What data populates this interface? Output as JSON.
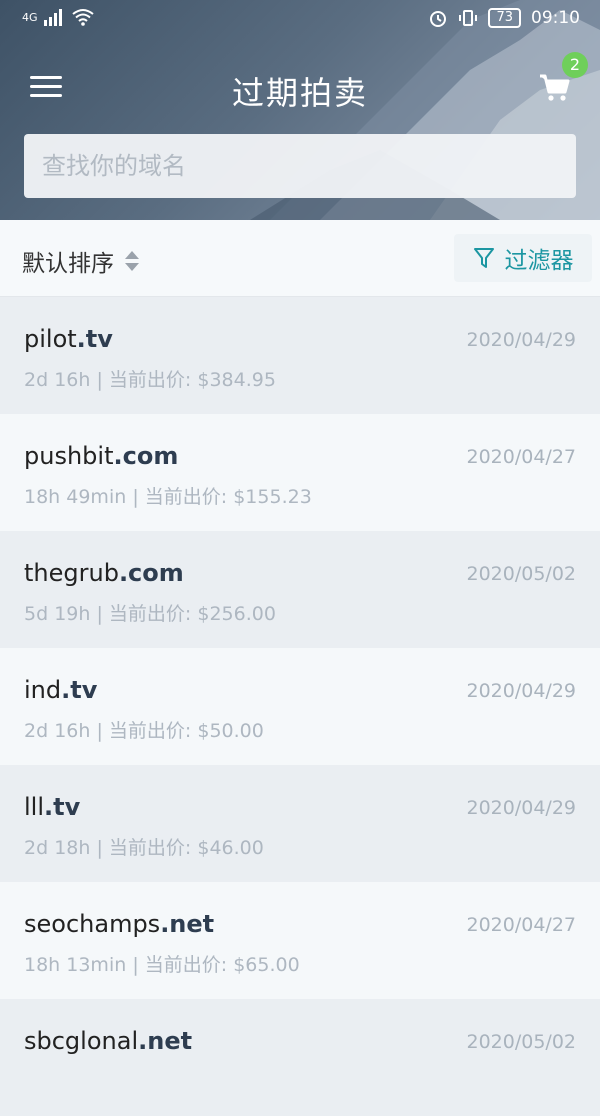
{
  "status_bar": {
    "network": "4G",
    "battery": "73",
    "time": "09:10"
  },
  "header": {
    "title": "过期拍卖",
    "cart_count": "2",
    "search_placeholder": "查找你的域名"
  },
  "toolbar": {
    "sort_label": "默认排序",
    "filter_label": "过滤器"
  },
  "colors": {
    "accent": "#1c96a2",
    "badge": "#6fcf5a"
  },
  "items": [
    {
      "name": "pilot",
      "tld": ".tv",
      "time": "2d  16h",
      "sep": "|",
      "bid_label": "当前出价:",
      "price": "$384.95",
      "date": "2020/04/29"
    },
    {
      "name": "pushbit",
      "tld": ".com",
      "time": "18h  49min",
      "sep": "|",
      "bid_label": "当前出价:",
      "price": "$155.23",
      "date": "2020/04/27"
    },
    {
      "name": "thegrub",
      "tld": ".com",
      "time": "5d  19h",
      "sep": "|",
      "bid_label": "当前出价:",
      "price": "$256.00",
      "date": "2020/05/02"
    },
    {
      "name": "ind",
      "tld": ".tv",
      "time": "2d  16h",
      "sep": "|",
      "bid_label": "当前出价:",
      "price": "$50.00",
      "date": "2020/04/29"
    },
    {
      "name": "lll",
      "tld": ".tv",
      "time": "2d  18h",
      "sep": "|",
      "bid_label": "当前出价:",
      "price": "$46.00",
      "date": "2020/04/29"
    },
    {
      "name": "seochamps",
      "tld": ".net",
      "time": "18h  13min",
      "sep": "|",
      "bid_label": "当前出价:",
      "price": "$65.00",
      "date": "2020/04/27"
    },
    {
      "name": "sbcglonal",
      "tld": ".net",
      "time": "",
      "sep": "",
      "bid_label": "",
      "price": "",
      "date": "2020/05/02"
    }
  ]
}
